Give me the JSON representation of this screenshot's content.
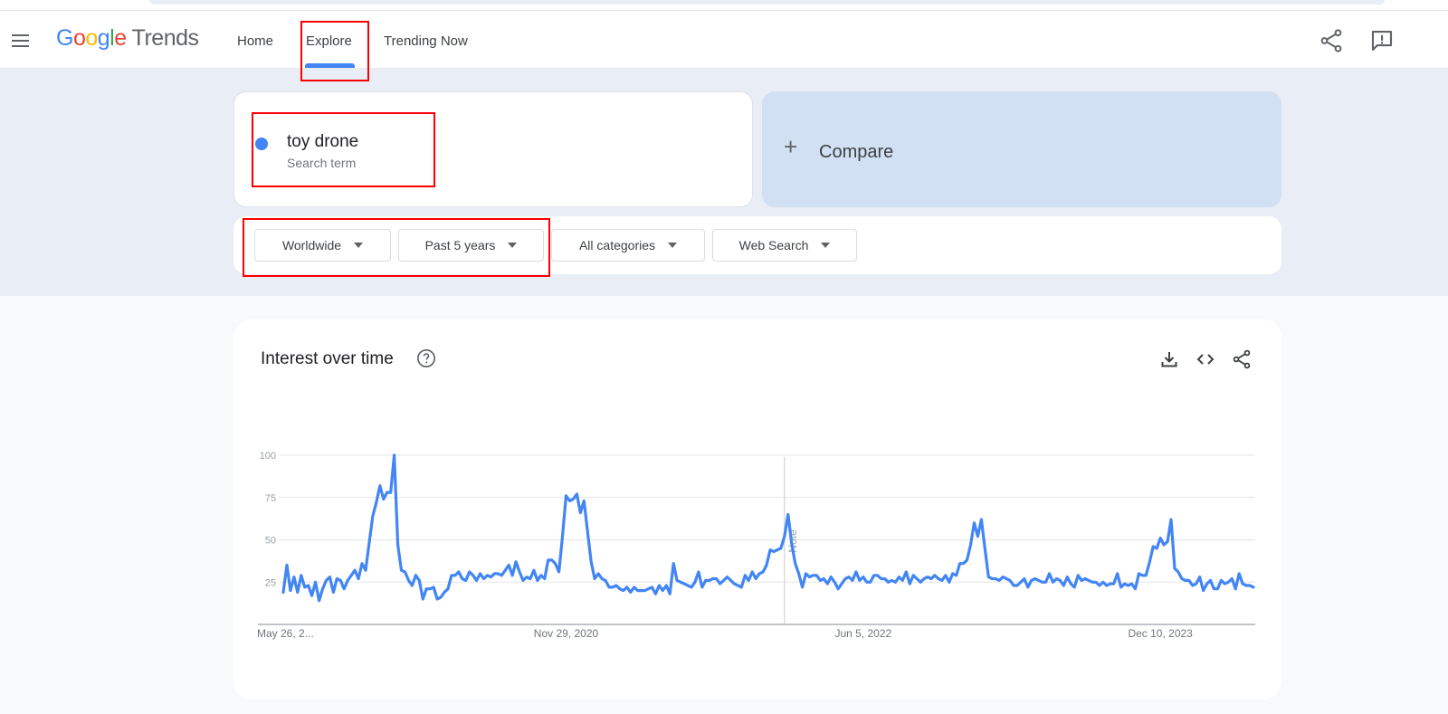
{
  "header": {
    "logo_google": "Google",
    "logo_trends": "Trends",
    "nav": [
      "Home",
      "Explore",
      "Trending Now"
    ],
    "active_nav": "Explore",
    "accent": "#4285f4"
  },
  "search": {
    "term": "toy drone",
    "term_type": "Search term",
    "term_color": "#4285f4",
    "compare_label": "Compare"
  },
  "filters": {
    "region": "Worldwide",
    "time_range": "Past 5 years",
    "category": "All categories",
    "search_type": "Web Search"
  },
  "icons": {
    "menu": "hamburger-icon",
    "share": "share-icon",
    "feedback": "feedback-icon",
    "help": "help-icon",
    "download": "download-icon",
    "embed": "embed-icon"
  },
  "chart_section": {
    "title": "Interest over time"
  },
  "chart_data": {
    "type": "line",
    "title": "",
    "xlabel": "",
    "ylabel": "",
    "ylim": [
      0,
      100
    ],
    "yticks": [
      25,
      50,
      75,
      100
    ],
    "x_tick_labels": [
      "May 26, 2...",
      "Nov 29, 2020",
      "Jun 5, 2022",
      "Dec 10, 2023"
    ],
    "x_tick_index": [
      0,
      79,
      162,
      245
    ],
    "annotation": "Note",
    "annotation_index": 140,
    "grid": true,
    "line_color": "#4285f4",
    "series": [
      {
        "values": [
          19,
          35,
          20,
          28,
          19,
          29,
          22,
          23,
          17,
          25,
          14,
          21,
          26,
          28,
          19,
          27,
          26,
          21,
          26,
          29,
          32,
          27,
          36,
          32,
          48,
          64,
          72,
          82,
          74,
          78,
          78,
          100,
          47,
          32,
          31,
          26,
          23,
          29,
          26,
          15,
          21,
          21,
          22,
          15,
          16,
          19,
          21,
          29,
          29,
          31,
          27,
          26,
          31,
          29,
          26,
          30,
          27,
          29,
          28,
          30,
          30,
          29,
          32,
          35,
          29,
          37,
          31,
          26,
          28,
          27,
          32,
          26,
          29,
          27,
          38,
          38,
          36,
          31,
          52,
          76,
          73,
          74,
          77,
          66,
          73,
          55,
          37,
          27,
          30,
          27,
          26,
          22,
          22,
          23,
          21,
          20,
          22,
          19,
          22,
          20,
          20,
          20,
          21,
          22,
          18,
          23,
          20,
          23,
          18,
          36,
          26,
          25,
          24,
          23,
          22,
          25,
          31,
          22,
          26,
          26,
          27,
          27,
          24,
          26,
          28,
          26,
          24,
          23,
          22,
          29,
          26,
          31,
          27,
          30,
          31,
          35,
          44,
          43,
          44,
          45,
          52,
          65,
          48,
          36,
          30,
          22,
          30,
          28,
          29,
          29,
          26,
          27,
          24,
          28,
          25,
          21,
          24,
          27,
          28,
          26,
          31,
          26,
          28,
          25,
          25,
          29,
          29,
          27,
          27,
          25,
          26,
          25,
          28,
          26,
          31,
          24,
          29,
          27,
          25,
          27,
          28,
          27,
          29,
          27,
          26,
          29,
          25,
          30,
          29,
          36,
          36,
          38,
          47,
          60,
          52,
          62,
          45,
          28,
          27,
          27,
          26,
          28,
          27,
          26,
          23,
          23,
          25,
          27,
          22,
          26,
          27,
          26,
          25,
          25,
          30,
          25,
          27,
          26,
          23,
          28,
          24,
          22,
          29,
          26,
          27,
          26,
          25,
          25,
          23,
          25,
          23,
          24,
          24,
          30,
          22,
          24,
          23,
          24,
          21,
          30,
          29,
          29,
          37,
          46,
          45,
          51,
          47,
          49,
          62,
          33,
          31,
          27,
          26,
          26,
          23,
          24,
          28,
          20,
          24,
          26,
          21,
          21,
          26,
          24,
          25,
          27,
          21,
          30,
          24,
          23,
          23,
          22
        ]
      }
    ]
  }
}
